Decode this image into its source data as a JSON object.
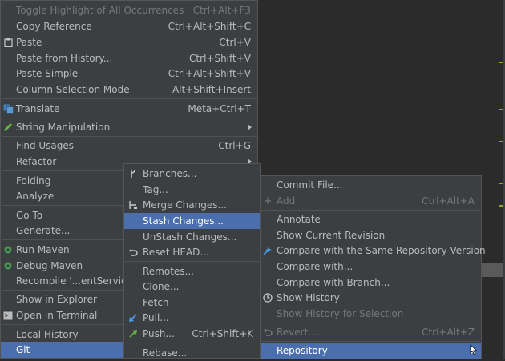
{
  "colors": {
    "menu_bg": "#3c3f41",
    "selected_bg": "#4b6eaf",
    "editor_bg": "#2b2b2b",
    "disabled_text": "#777777"
  },
  "main_menu": {
    "items": [
      {
        "label": "Toggle Highlight of All Occurrences",
        "shortcut": "Ctrl+Alt+F3",
        "disabled": true
      },
      {
        "label": "Copy Reference",
        "shortcut": "Ctrl+Alt+Shift+C"
      },
      {
        "label": "Paste",
        "shortcut": "Ctrl+V",
        "icon": "clipboard-icon"
      },
      {
        "label": "Paste from History...",
        "shortcut": "Ctrl+Shift+V"
      },
      {
        "label": "Paste Simple",
        "shortcut": "Ctrl+Alt+Shift+V"
      },
      {
        "label": "Column Selection Mode",
        "shortcut": "Alt+Shift+Insert"
      },
      {
        "label": "Translate",
        "shortcut": "Meta+Ctrl+T",
        "icon": "translate-icon"
      },
      {
        "label": "String Manipulation",
        "shortcut": "",
        "icon": "pencil-icon",
        "submenu": true
      },
      {
        "label": "Find Usages",
        "shortcut": "Ctrl+G"
      },
      {
        "label": "Refactor",
        "shortcut": "",
        "submenu": true
      },
      {
        "label": "Folding",
        "shortcut": ""
      },
      {
        "label": "Analyze",
        "shortcut": ""
      },
      {
        "label": "Go To",
        "shortcut": ""
      },
      {
        "label": "Generate...",
        "shortcut": ""
      },
      {
        "label": "Run Maven",
        "shortcut": "",
        "icon": "gear-icon"
      },
      {
        "label": "Debug Maven",
        "shortcut": "",
        "icon": "gear-debug-icon"
      },
      {
        "label": "Recompile '...entServiceI",
        "shortcut": ""
      },
      {
        "label": "Show in Explorer",
        "shortcut": ""
      },
      {
        "label": "Open in Terminal",
        "shortcut": "",
        "icon": "terminal-icon"
      },
      {
        "label": "Local History",
        "shortcut": ""
      },
      {
        "label": "Git",
        "shortcut": "",
        "selected": true
      }
    ]
  },
  "git_menu": {
    "items": [
      {
        "label": "Branches...",
        "icon": "branch-icon"
      },
      {
        "label": "Tag..."
      },
      {
        "label": "Merge Changes...",
        "icon": "merge-icon"
      },
      {
        "label": "Stash Changes...",
        "selected": true
      },
      {
        "label": "UnStash Changes..."
      },
      {
        "label": "Reset HEAD...",
        "icon": "undo-icon"
      },
      {
        "label": "Remotes..."
      },
      {
        "label": "Clone..."
      },
      {
        "label": "Fetch"
      },
      {
        "label": "Pull...",
        "icon": "pull-arrow-icon"
      },
      {
        "label": "Push...",
        "shortcut": "Ctrl+Shift+K",
        "icon": "push-arrow-icon"
      },
      {
        "label": "Rebase..."
      }
    ]
  },
  "repository_menu": {
    "items": [
      {
        "label": "Commit File..."
      },
      {
        "label": "Add",
        "shortcut": "Ctrl+Alt+A",
        "disabled": true,
        "icon": "plus-icon"
      },
      {
        "label": "Annotate"
      },
      {
        "label": "Show Current Revision"
      },
      {
        "label": "Compare with the Same Repository Version",
        "icon": "compare-icon"
      },
      {
        "label": "Compare with..."
      },
      {
        "label": "Compare with Branch..."
      },
      {
        "label": "Show History",
        "icon": "clock-icon"
      },
      {
        "label": "Show History for Selection",
        "disabled": true
      },
      {
        "label": "Revert...",
        "shortcut": "Ctrl+Alt+Z",
        "disabled": true,
        "icon": "revert-icon"
      },
      {
        "label": "Repository",
        "selected": true,
        "submenu": true
      }
    ]
  }
}
